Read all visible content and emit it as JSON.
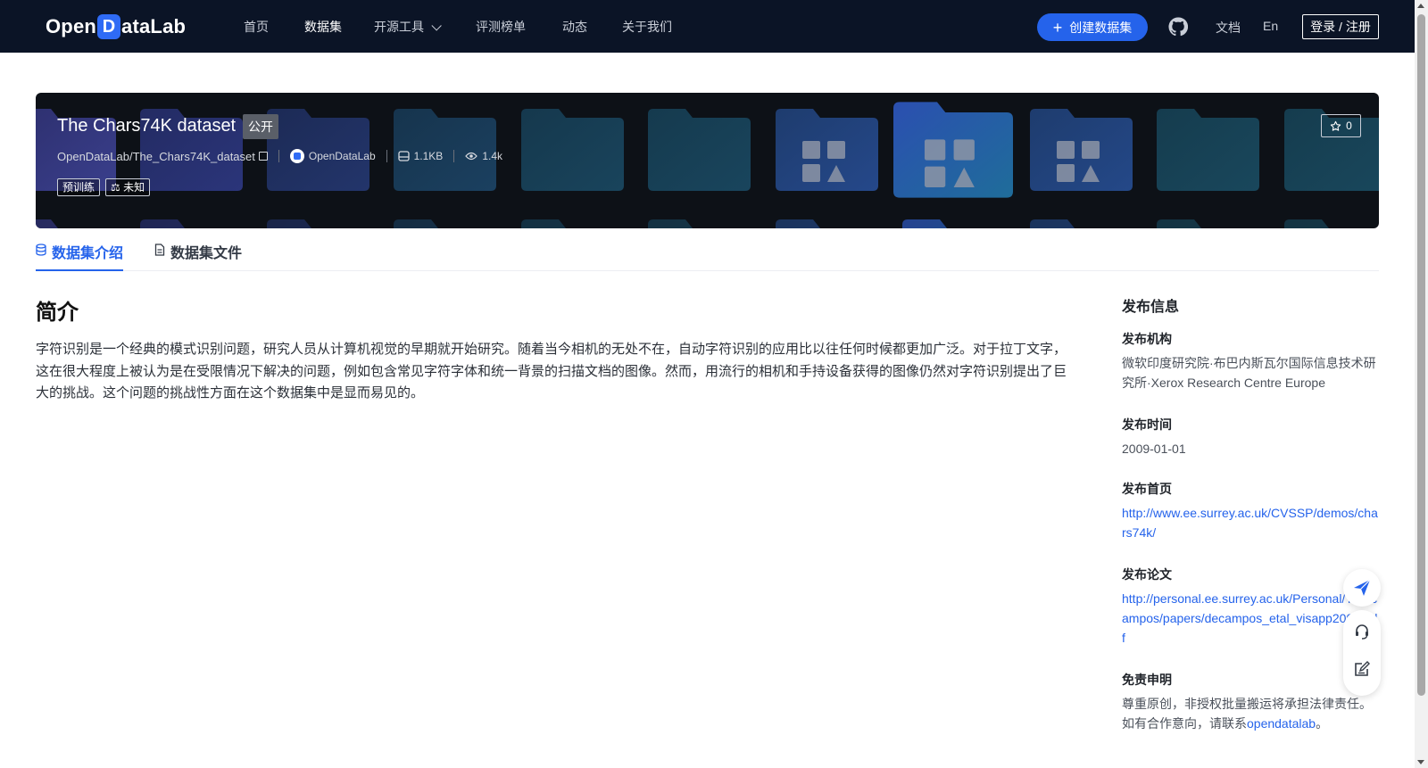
{
  "nav": {
    "logo_prefix": "Open",
    "logo_d": "D",
    "logo_suffix": "ataLab",
    "items": [
      "首页",
      "数据集",
      "开源工具",
      "评测榜单",
      "动态",
      "关于我们"
    ],
    "active_item": "数据集",
    "create_button": "创建数据集",
    "docs": "文档",
    "lang": "En",
    "login": "登录 / 注册"
  },
  "dataset": {
    "title": "The Chars74K dataset",
    "visibility": "公开",
    "path": "OpenDataLab/The_Chars74K_dataset",
    "org": "OpenDataLab",
    "size": "1.1KB",
    "views": "1.4k",
    "tags": [
      "预训练",
      "未知"
    ],
    "stars": "0"
  },
  "tabs": [
    {
      "label": "数据集介绍",
      "active": true
    },
    {
      "label": "数据集文件",
      "active": false
    }
  ],
  "intro": {
    "heading": "简介",
    "text": "字符识别是一个经典的模式识别问题，研究人员从计算机视觉的早期就开始研究。随着当今相机的无处不在，自动字符识别的应用比以往任何时候都更加广泛。对于拉丁文字，这在很大程度上被认为是在受限情况下解决的问题，例如包含常见字符字体和统一背景的扫描文档的图像。然而，用流行的相机和手持设备获得的图像仍然对字符识别提出了巨大的挑战。这个问题的挑战性方面在这个数据集中是显而易见的。"
  },
  "sidebar": {
    "title": "发布信息",
    "publisher_label": "发布机构",
    "publisher": "微软印度研究院·布巴内斯瓦尔国际信息技术研究所·Xerox Research Centre Europe",
    "date_label": "发布时间",
    "date": "2009-01-01",
    "homepage_label": "发布首页",
    "homepage": "http://www.ee.surrey.ac.uk/CVSSP/demos/chars74k/",
    "paper_label": "发布论文",
    "paper": "http://personal.ee.surrey.ac.uk/Personal/T.Decampos/papers/decampos_etal_visapp2009.pdf",
    "disclaimer_label": "免责申明",
    "disclaimer_text": "尊重原创，非授权批量搬运将承担法律责任。如有合作意向，请联系",
    "disclaimer_link": "opendatalab",
    "disclaimer_end": "。"
  },
  "icons": {
    "github": "github-icon",
    "star": "star-icon",
    "float_top": "paper-plane-icon",
    "float_support": "headset-icon",
    "float_feedback": "edit-note-icon"
  },
  "colors": {
    "accent": "#2563eb",
    "nav_bg": "#0b1426",
    "hero_bg": "#0d1117"
  }
}
